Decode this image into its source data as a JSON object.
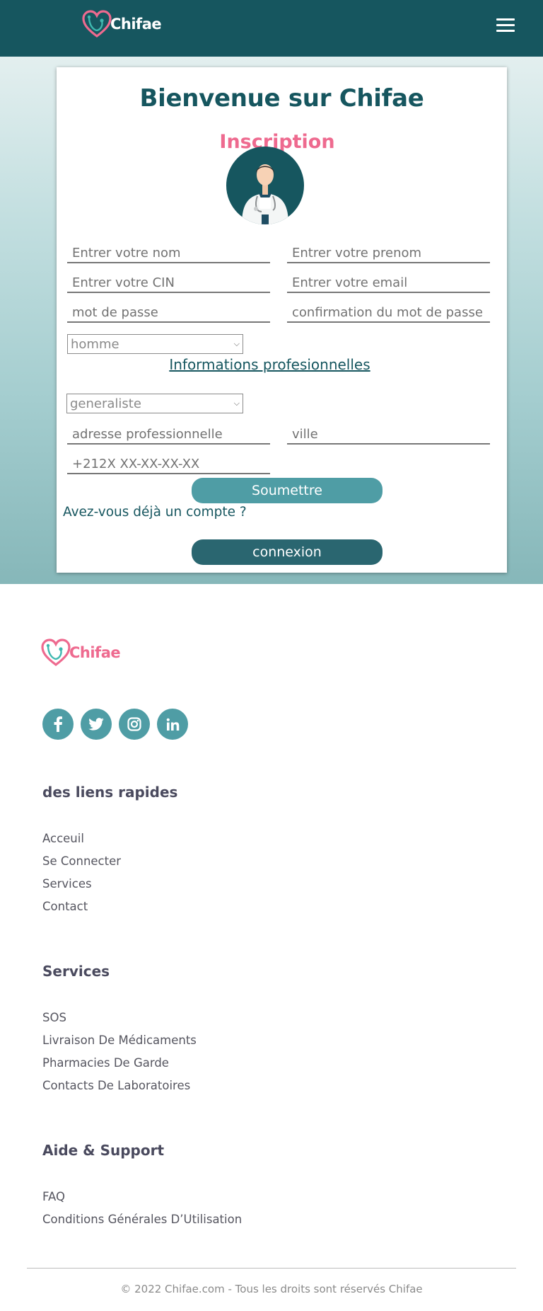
{
  "brand": {
    "name": "Chifae",
    "primary": "#16565f",
    "accent": "#ee6a8f",
    "button": "#4f9da5"
  },
  "header": {
    "menu_icon": "hamburger-icon"
  },
  "form": {
    "title": "Bienvenue sur Chifae",
    "subtitle": "Inscription",
    "nom_placeholder": "Entrer votre nom",
    "prenom_placeholder": "Entrer votre prenom",
    "cin_placeholder": "Entrer votre CIN",
    "email_placeholder": "Entrer votre email",
    "password_placeholder": "mot de passe",
    "confirm_placeholder": "confirmation du mot de passe",
    "gender_selected": "homme",
    "pro_section_label": "Informations profesionnelles",
    "specialty_selected": "generaliste",
    "address_placeholder": "adresse professionnelle",
    "city_placeholder": "ville",
    "phone_placeholder": "+212X XX-XX-XX-XX",
    "submit_label": "Soumettre",
    "have_account_text": "Avez-vous déjà un compte ?",
    "login_label": "connexion"
  },
  "footer": {
    "socials": [
      "facebook-icon",
      "twitter-icon",
      "instagram-icon",
      "linkedin-icon"
    ],
    "quick_links_title": "des liens rapides",
    "quick_links": [
      "Acceuil",
      "Se Connecter",
      "Services",
      "Contact"
    ],
    "services_title": "Services",
    "services": [
      "SOS",
      "Livraison De Médicaments",
      "Pharmacies De Garde",
      "Contacts De Laboratoires"
    ],
    "support_title": "Aide & Support",
    "support": [
      "FAQ",
      "Conditions Générales D’Utilisation"
    ],
    "copyright": "© 2022 Chifae.com - Tous les droits sont réservés Chifae"
  }
}
